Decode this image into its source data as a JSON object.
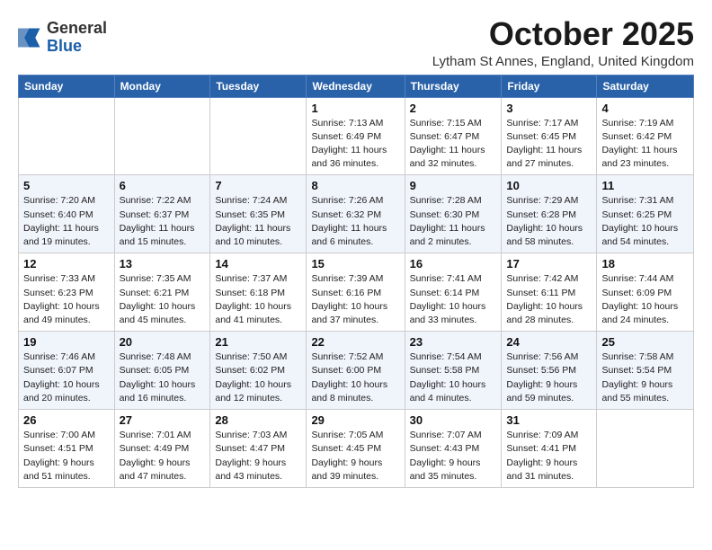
{
  "header": {
    "logo_general": "General",
    "logo_blue": "Blue",
    "month_title": "October 2025",
    "location": "Lytham St Annes, England, United Kingdom"
  },
  "weekdays": [
    "Sunday",
    "Monday",
    "Tuesday",
    "Wednesday",
    "Thursday",
    "Friday",
    "Saturday"
  ],
  "weeks": [
    [
      {
        "day": "",
        "info": ""
      },
      {
        "day": "",
        "info": ""
      },
      {
        "day": "",
        "info": ""
      },
      {
        "day": "1",
        "info": "Sunrise: 7:13 AM\nSunset: 6:49 PM\nDaylight: 11 hours\nand 36 minutes."
      },
      {
        "day": "2",
        "info": "Sunrise: 7:15 AM\nSunset: 6:47 PM\nDaylight: 11 hours\nand 32 minutes."
      },
      {
        "day": "3",
        "info": "Sunrise: 7:17 AM\nSunset: 6:45 PM\nDaylight: 11 hours\nand 27 minutes."
      },
      {
        "day": "4",
        "info": "Sunrise: 7:19 AM\nSunset: 6:42 PM\nDaylight: 11 hours\nand 23 minutes."
      }
    ],
    [
      {
        "day": "5",
        "info": "Sunrise: 7:20 AM\nSunset: 6:40 PM\nDaylight: 11 hours\nand 19 minutes."
      },
      {
        "day": "6",
        "info": "Sunrise: 7:22 AM\nSunset: 6:37 PM\nDaylight: 11 hours\nand 15 minutes."
      },
      {
        "day": "7",
        "info": "Sunrise: 7:24 AM\nSunset: 6:35 PM\nDaylight: 11 hours\nand 10 minutes."
      },
      {
        "day": "8",
        "info": "Sunrise: 7:26 AM\nSunset: 6:32 PM\nDaylight: 11 hours\nand 6 minutes."
      },
      {
        "day": "9",
        "info": "Sunrise: 7:28 AM\nSunset: 6:30 PM\nDaylight: 11 hours\nand 2 minutes."
      },
      {
        "day": "10",
        "info": "Sunrise: 7:29 AM\nSunset: 6:28 PM\nDaylight: 10 hours\nand 58 minutes."
      },
      {
        "day": "11",
        "info": "Sunrise: 7:31 AM\nSunset: 6:25 PM\nDaylight: 10 hours\nand 54 minutes."
      }
    ],
    [
      {
        "day": "12",
        "info": "Sunrise: 7:33 AM\nSunset: 6:23 PM\nDaylight: 10 hours\nand 49 minutes."
      },
      {
        "day": "13",
        "info": "Sunrise: 7:35 AM\nSunset: 6:21 PM\nDaylight: 10 hours\nand 45 minutes."
      },
      {
        "day": "14",
        "info": "Sunrise: 7:37 AM\nSunset: 6:18 PM\nDaylight: 10 hours\nand 41 minutes."
      },
      {
        "day": "15",
        "info": "Sunrise: 7:39 AM\nSunset: 6:16 PM\nDaylight: 10 hours\nand 37 minutes."
      },
      {
        "day": "16",
        "info": "Sunrise: 7:41 AM\nSunset: 6:14 PM\nDaylight: 10 hours\nand 33 minutes."
      },
      {
        "day": "17",
        "info": "Sunrise: 7:42 AM\nSunset: 6:11 PM\nDaylight: 10 hours\nand 28 minutes."
      },
      {
        "day": "18",
        "info": "Sunrise: 7:44 AM\nSunset: 6:09 PM\nDaylight: 10 hours\nand 24 minutes."
      }
    ],
    [
      {
        "day": "19",
        "info": "Sunrise: 7:46 AM\nSunset: 6:07 PM\nDaylight: 10 hours\nand 20 minutes."
      },
      {
        "day": "20",
        "info": "Sunrise: 7:48 AM\nSunset: 6:05 PM\nDaylight: 10 hours\nand 16 minutes."
      },
      {
        "day": "21",
        "info": "Sunrise: 7:50 AM\nSunset: 6:02 PM\nDaylight: 10 hours\nand 12 minutes."
      },
      {
        "day": "22",
        "info": "Sunrise: 7:52 AM\nSunset: 6:00 PM\nDaylight: 10 hours\nand 8 minutes."
      },
      {
        "day": "23",
        "info": "Sunrise: 7:54 AM\nSunset: 5:58 PM\nDaylight: 10 hours\nand 4 minutes."
      },
      {
        "day": "24",
        "info": "Sunrise: 7:56 AM\nSunset: 5:56 PM\nDaylight: 9 hours\nand 59 minutes."
      },
      {
        "day": "25",
        "info": "Sunrise: 7:58 AM\nSunset: 5:54 PM\nDaylight: 9 hours\nand 55 minutes."
      }
    ],
    [
      {
        "day": "26",
        "info": "Sunrise: 7:00 AM\nSunset: 4:51 PM\nDaylight: 9 hours\nand 51 minutes."
      },
      {
        "day": "27",
        "info": "Sunrise: 7:01 AM\nSunset: 4:49 PM\nDaylight: 9 hours\nand 47 minutes."
      },
      {
        "day": "28",
        "info": "Sunrise: 7:03 AM\nSunset: 4:47 PM\nDaylight: 9 hours\nand 43 minutes."
      },
      {
        "day": "29",
        "info": "Sunrise: 7:05 AM\nSunset: 4:45 PM\nDaylight: 9 hours\nand 39 minutes."
      },
      {
        "day": "30",
        "info": "Sunrise: 7:07 AM\nSunset: 4:43 PM\nDaylight: 9 hours\nand 35 minutes."
      },
      {
        "day": "31",
        "info": "Sunrise: 7:09 AM\nSunset: 4:41 PM\nDaylight: 9 hours\nand 31 minutes."
      },
      {
        "day": "",
        "info": ""
      }
    ]
  ]
}
